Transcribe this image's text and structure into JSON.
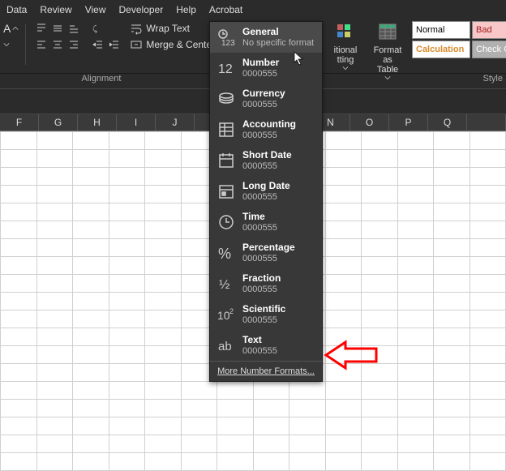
{
  "tabs": {
    "data": "Data",
    "review": "Review",
    "view": "View",
    "developer": "Developer",
    "help": "Help",
    "acrobat": "Acrobat"
  },
  "ribbon": {
    "wrap_text": "Wrap Text",
    "merge_center": "Merge & Center",
    "alignment_label": "Alignment",
    "conditional_formatting": "itional\ntting",
    "format_as_table": "Format as\nTable",
    "styles_label": "Style"
  },
  "styles_cells": {
    "normal": "Normal",
    "bad": "Bad",
    "calculation": "Calculation",
    "check": "Check C"
  },
  "dropdown": {
    "items": [
      {
        "name": "General",
        "sub": "No specific format",
        "icon": "general"
      },
      {
        "name": "Number",
        "sub": "0000555",
        "icon": "number"
      },
      {
        "name": "Currency",
        "sub": "0000555",
        "icon": "currency"
      },
      {
        "name": "Accounting",
        "sub": "0000555",
        "icon": "accounting"
      },
      {
        "name": "Short Date",
        "sub": "0000555",
        "icon": "shortdate"
      },
      {
        "name": "Long Date",
        "sub": "0000555",
        "icon": "longdate"
      },
      {
        "name": "Time",
        "sub": "0000555",
        "icon": "time"
      },
      {
        "name": "Percentage",
        "sub": "0000555",
        "icon": "percentage"
      },
      {
        "name": "Fraction",
        "sub": "0000555",
        "icon": "fraction"
      },
      {
        "name": "Scientific",
        "sub": "0000555",
        "icon": "scientific"
      },
      {
        "name": "Text",
        "sub": "0000555",
        "icon": "text"
      }
    ],
    "more": "More Number Formats..."
  },
  "columns": [
    "F",
    "G",
    "H",
    "I",
    "J",
    "",
    "",
    "",
    "N",
    "O",
    "P",
    "Q",
    ""
  ],
  "colors": {
    "bad_bg": "#f8c7c7",
    "bad_fg": "#a02020",
    "calc_fg": "#d88b2e",
    "check_bg": "#b0b0b0"
  }
}
